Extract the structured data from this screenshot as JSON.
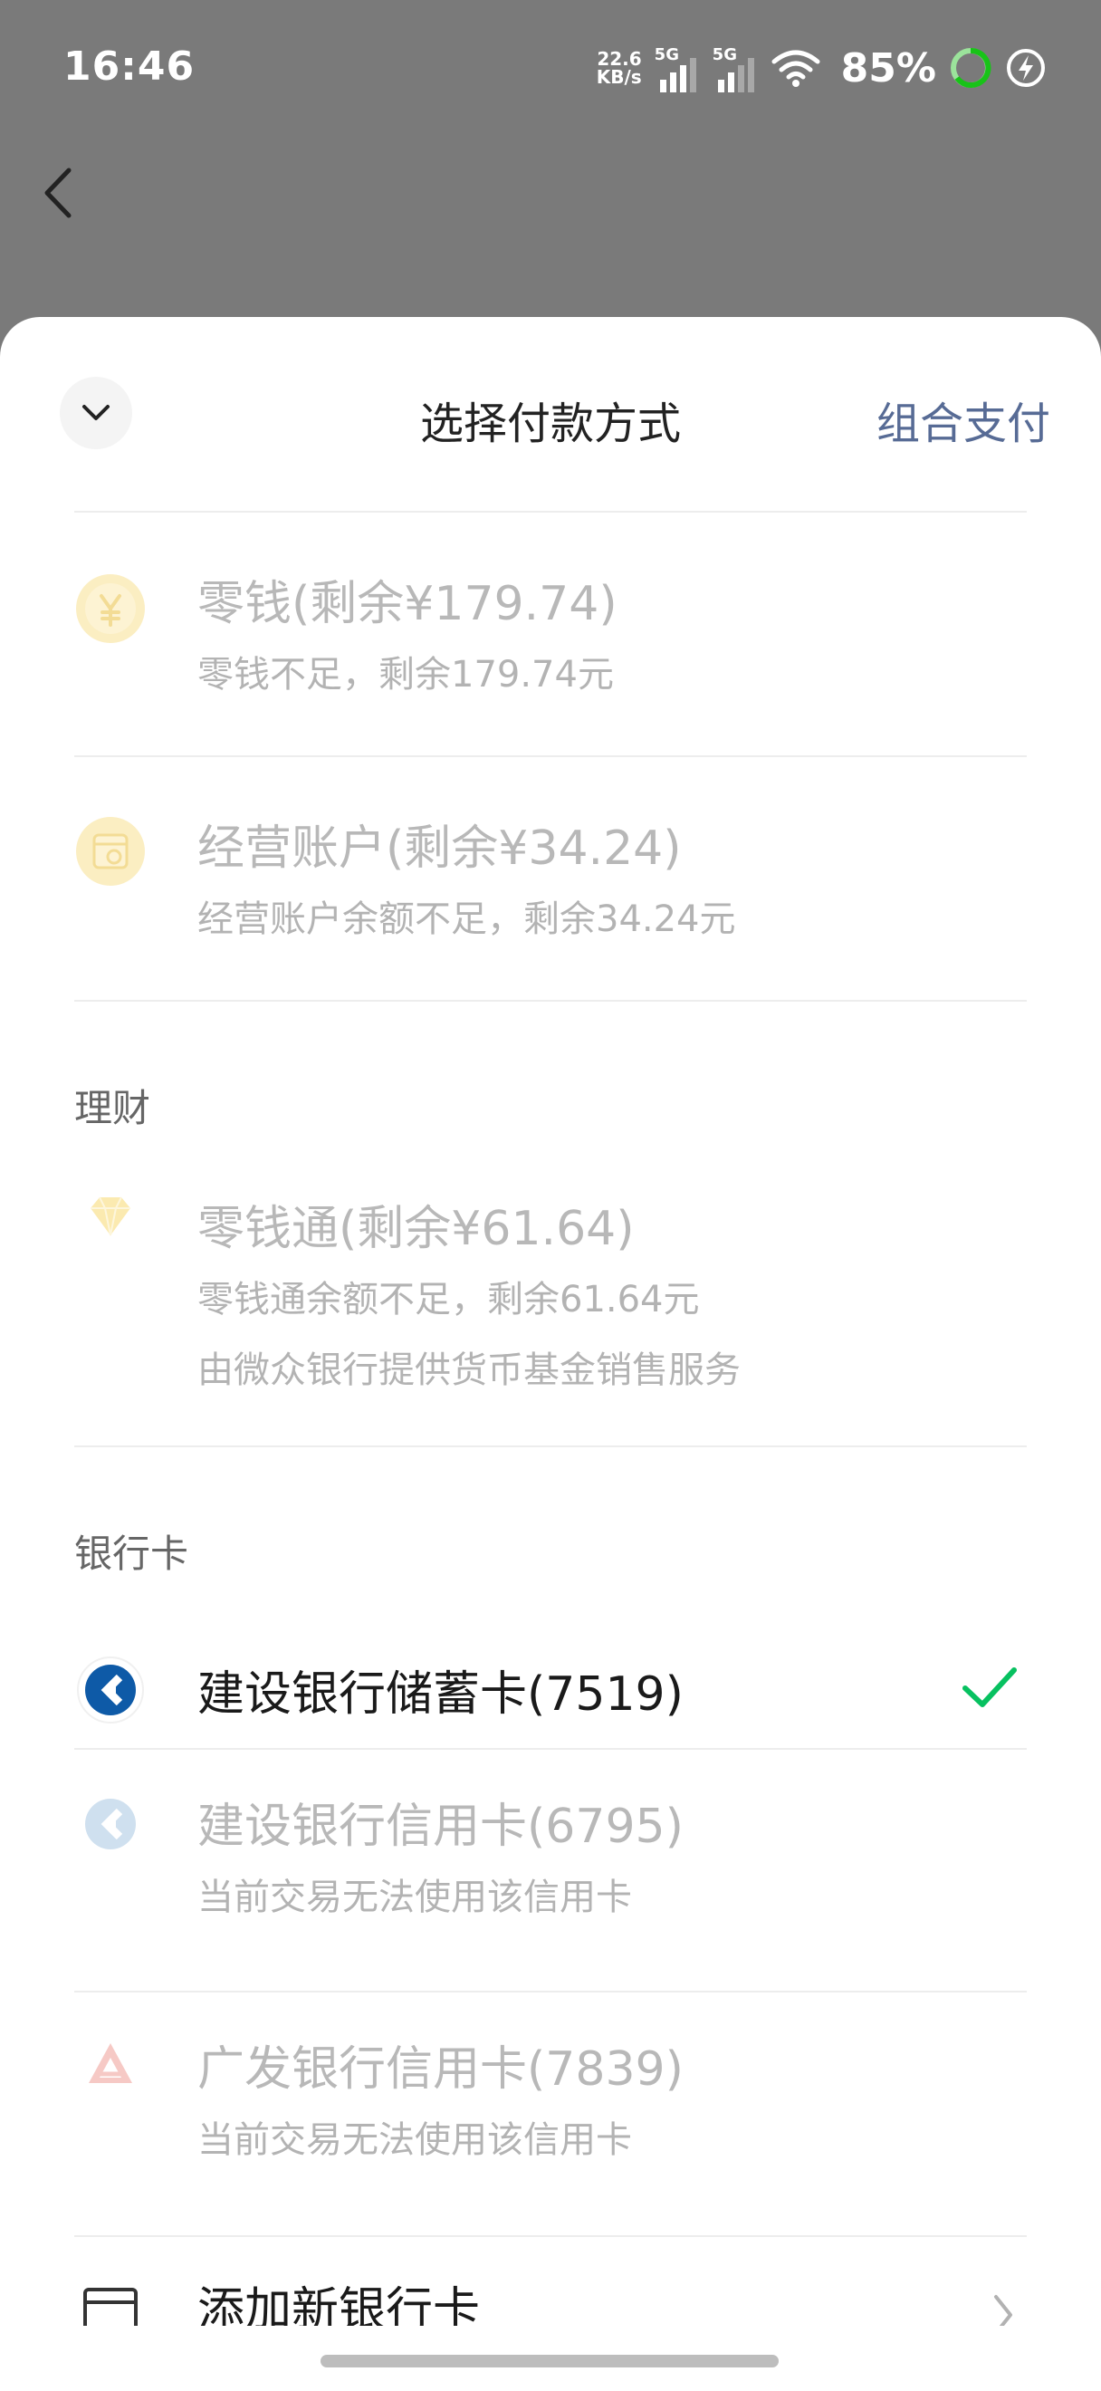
{
  "status_bar": {
    "time": "16:46",
    "net_speed_value": "22.6",
    "net_speed_unit": "KB/s",
    "signal_1_label": "5G",
    "signal_2_label": "5G",
    "battery": "85%"
  },
  "sheet": {
    "title": "选择付款方式",
    "combo_pay": "组合支付"
  },
  "options": {
    "change": {
      "title": "零钱(剩余¥179.74)",
      "sub": "零钱不足，剩余179.74元"
    },
    "business": {
      "title": "经营账户(剩余¥34.24)",
      "sub": "经营账户余额不足，剩余34.24元"
    }
  },
  "finance": {
    "section_label": "理财",
    "lingqiantong": {
      "title": "零钱通(剩余¥61.64)",
      "sub1": "零钱通余额不足，剩余61.64元",
      "sub2": "由微众银行提供货币基金销售服务"
    }
  },
  "bank": {
    "section_label": "银行卡",
    "ccb_debit": {
      "title": "建设银行储蓄卡(7519)"
    },
    "ccb_credit": {
      "title": "建设银行信用卡(6795)",
      "sub": "当前交易无法使用该信用卡"
    },
    "cgb_credit": {
      "title": "广发银行信用卡(7839)",
      "sub": "当前交易无法使用该信用卡"
    },
    "add_card": {
      "title": "添加新银行卡"
    }
  },
  "colors": {
    "accent_link": "#576b95",
    "check_green": "#07c160",
    "ccb_blue": "#0e5aa7",
    "cgb_red": "#e3514a",
    "coin_yellow": "#f5c542"
  }
}
